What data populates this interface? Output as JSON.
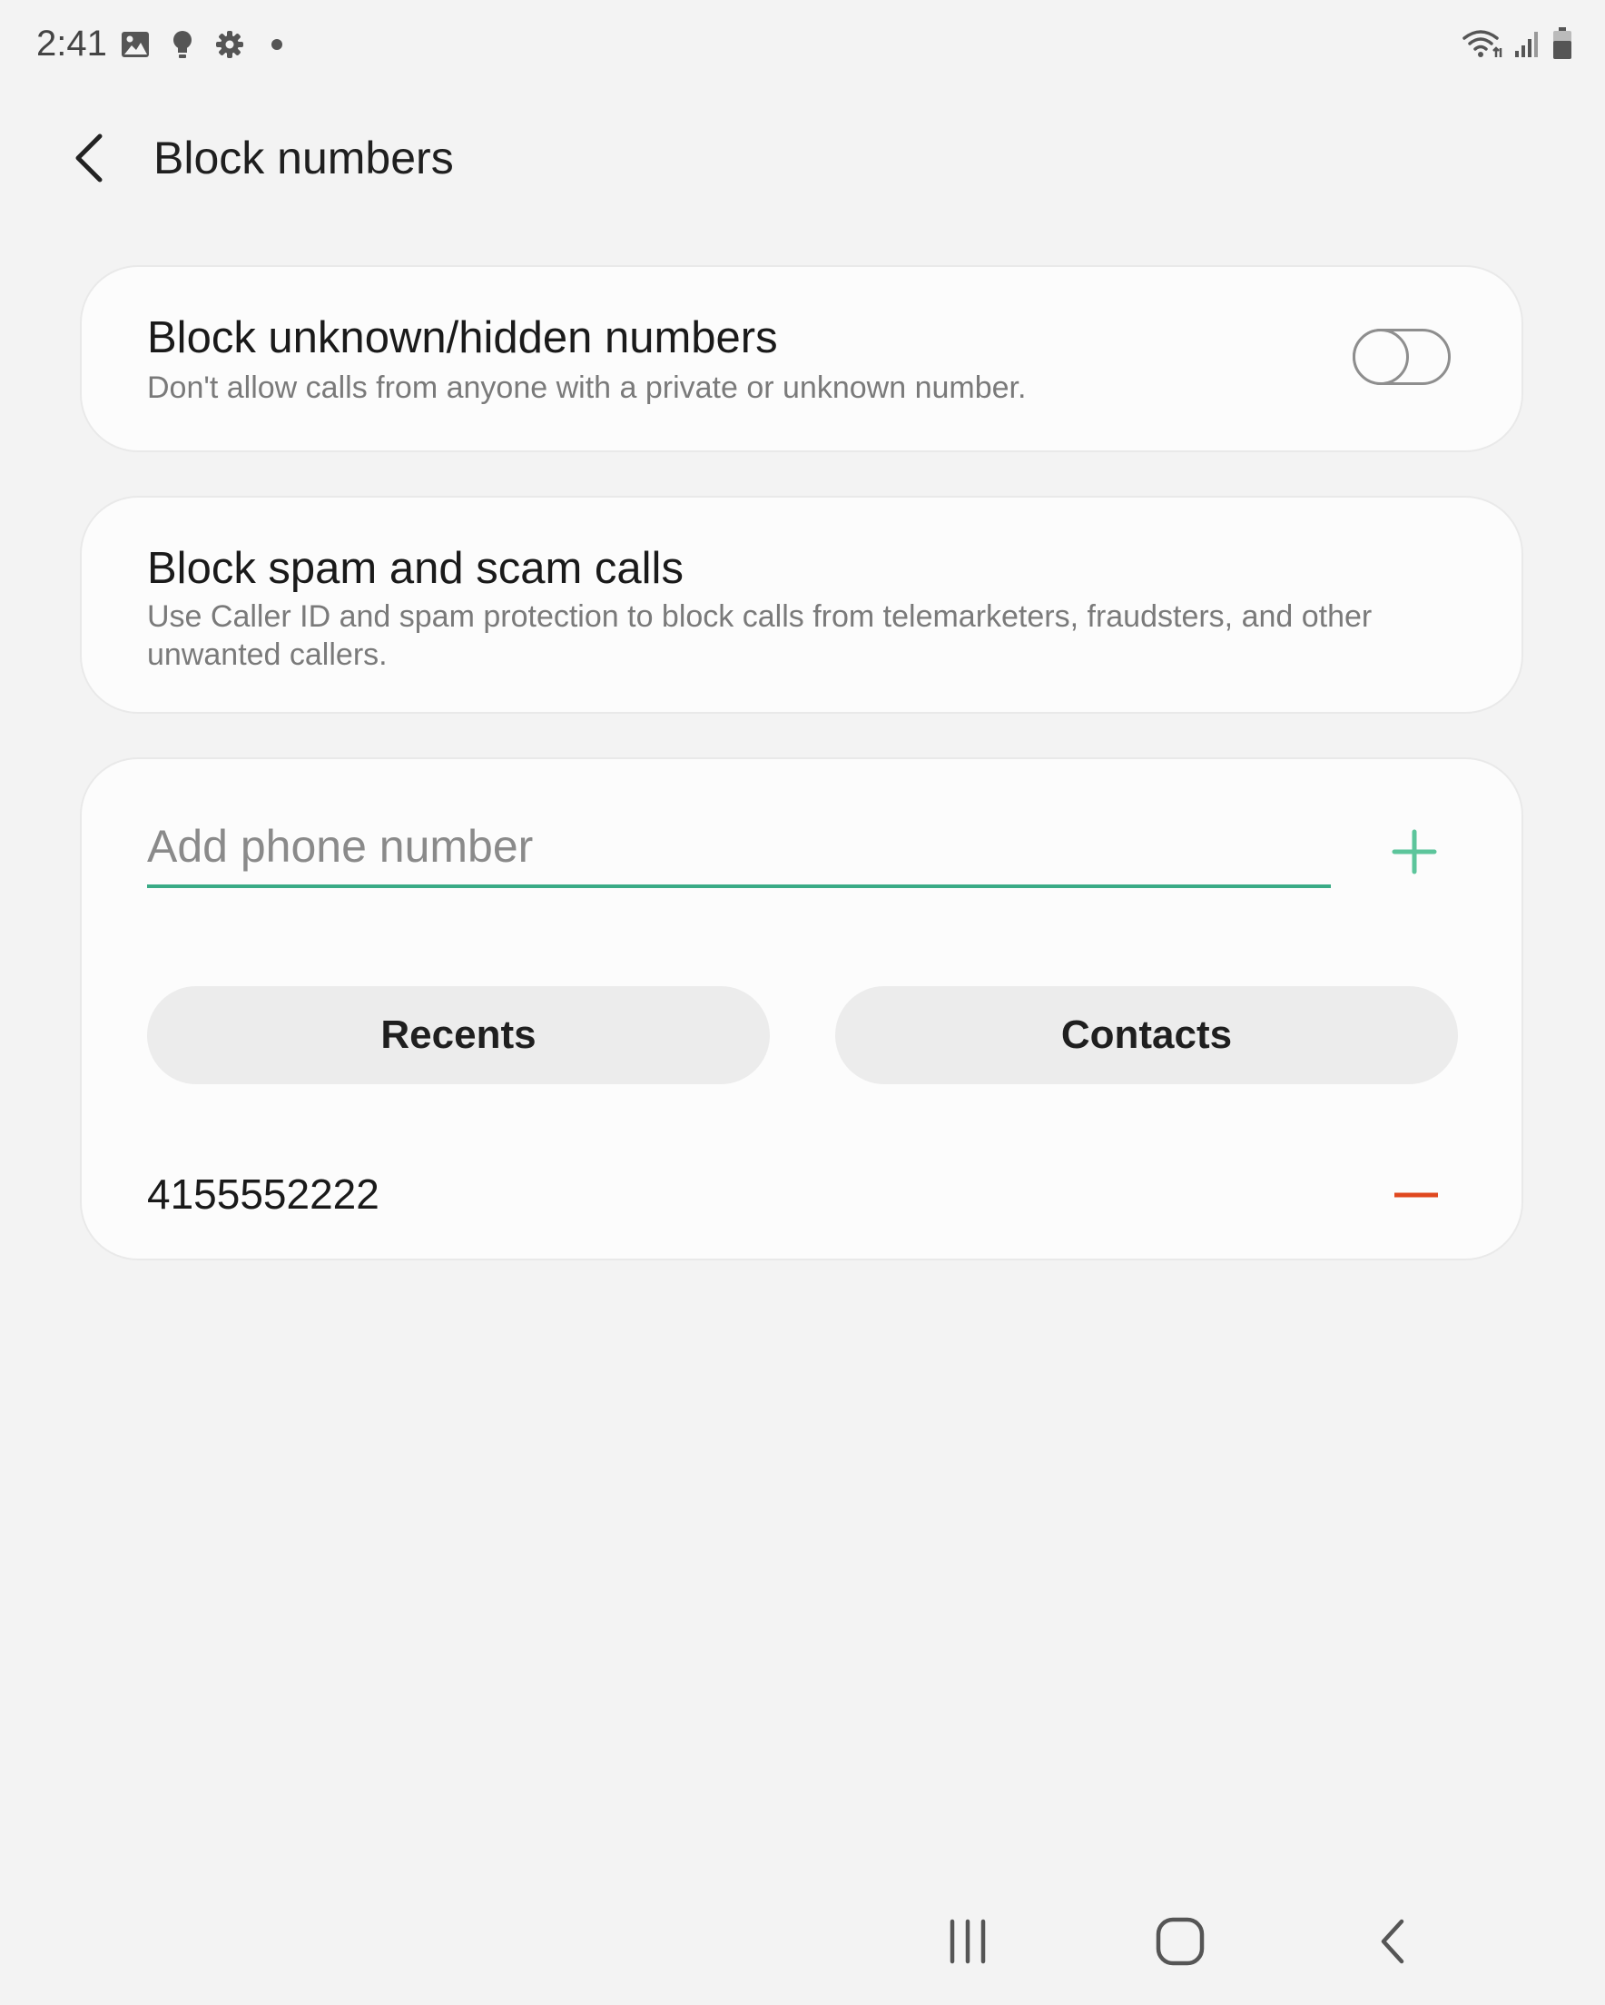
{
  "status_bar": {
    "time": "2:41",
    "left_icons": [
      "image-icon",
      "lightbulb-icon",
      "settings-icon",
      "dot-icon"
    ],
    "right_icons": [
      "wifi-icon",
      "signal-icon",
      "battery-icon"
    ]
  },
  "header": {
    "title": "Block numbers",
    "back_icon": "chevron-left-icon"
  },
  "unknown_card": {
    "title": "Block unknown/hidden numbers",
    "description": "Don't allow calls from anyone with a private or unknown number.",
    "toggle_on": false
  },
  "spam_card": {
    "title": "Block spam and scam calls",
    "description": "Use Caller ID and spam protection to block calls from telemarketers, fraudsters, and other unwanted callers."
  },
  "add_card": {
    "input_placeholder": "Add phone number",
    "input_value": "",
    "add_icon": "plus-icon",
    "recents_label": "Recents",
    "contacts_label": "Contacts",
    "blocked_numbers": [
      {
        "number": "4155552222",
        "remove_icon": "minus-icon"
      }
    ]
  },
  "nav_bar": {
    "items": [
      "recent-apps-icon",
      "home-icon",
      "back-icon"
    ]
  },
  "colors": {
    "background": "#f3f3f3",
    "card": "#fcfcfc",
    "accent_green": "#3aab86",
    "plus_green": "#5cc59b",
    "remove_red": "#e0481f",
    "muted_text": "#7a7a7a",
    "pill": "#ececec"
  }
}
